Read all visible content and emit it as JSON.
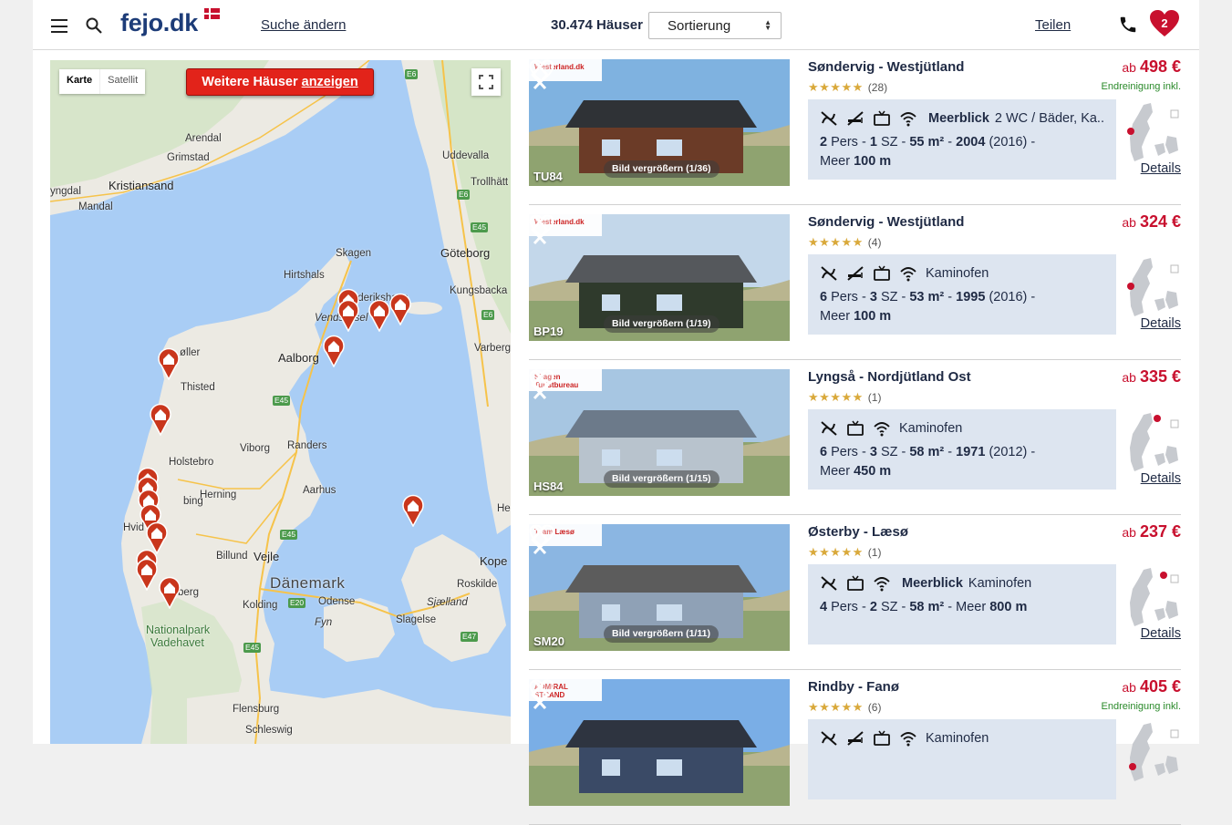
{
  "header": {
    "logo": "fejo.dk",
    "change_search": "Suche ändern",
    "result_count": "30.474 Häuser",
    "sort_label": "Sortierung",
    "share": "Teilen",
    "favorites_count": "2"
  },
  "map": {
    "type_map": "Karte",
    "type_satellite": "Satellit",
    "more_button_prefix": "Weitere Häuser",
    "more_button_link": "anzeigen",
    "labels": {
      "arendal": "Arendal",
      "grimstad": "Grimstad",
      "kristiansand": "Kristiansand",
      "mandal": "Mandal",
      "yngdal": "yngdal",
      "uddevalla": "Uddevalla",
      "trollhattan": "Trollhätt",
      "skagen": "Skagen",
      "goteborg": "Göteborg",
      "hirtshals": "Hirtshals",
      "frederikshavn": "Frederikshavn",
      "vendsyssel": "Vendsyssel",
      "kungsbacka": "Kungsbacka",
      "varberg": "Varberg",
      "aalborg": "Aalborg",
      "thisted": "Thisted",
      "holstebro": "Holstebro",
      "viborg": "Viborg",
      "randers": "Randers",
      "herning": "Herning",
      "aarhus": "Aarhus",
      "billund": "Billund",
      "vejle": "Vejle",
      "danemark": "Dänemark",
      "kolding": "Kolding",
      "odense": "Odense",
      "fyn": "Fyn",
      "sjaelland": "Sjælland",
      "roskilde": "Roskilde",
      "kope": "Kope",
      "slagelse": "Slagelse",
      "nationalpark": "Nationalpark",
      "vadehavet": "Vadehavet",
      "flensburg": "Flensburg",
      "schleswig": "Schleswig",
      "moller": "øller",
      "bing": "bing",
      "hvid": "Hvid",
      "berg": "berg",
      "he": "He"
    },
    "roads": {
      "e6a": "E6",
      "e6b": "E6",
      "e6c": "E6",
      "e45a": "E45",
      "e45b": "E45",
      "e45c": "E45",
      "e45d": "E45",
      "e6d": "E6",
      "e20": "E20",
      "e47": "E47",
      "e45e": "E45"
    }
  },
  "listings": [
    {
      "agency": "Westerland.dk",
      "code": "TU84",
      "enlarge": "Bild vergrößern (1/36)",
      "title": "Søndervig - Westjütland",
      "stars": "★★★★★",
      "rating_count": "(28)",
      "price_prefix": "ab",
      "price": "498 €",
      "cleaning": "Endreinigung inkl.",
      "highlight": "Meerblick",
      "features_text": "2 WC / Bäder, Ka...",
      "persons": "2",
      "persons_label": "Pers",
      "bedrooms": "1",
      "bedrooms_label": "SZ",
      "area": "55 m²",
      "year": "2004",
      "renovated": "(2016)",
      "sea_label": "Meer",
      "sea_distance": "100 m",
      "details": "Details"
    },
    {
      "agency": "Westerland.dk",
      "code": "BP19",
      "enlarge": "Bild vergrößern (1/19)",
      "title": "Søndervig - Westjütland",
      "stars": "★★★★★",
      "rating_count": "(4)",
      "price_prefix": "ab",
      "price": "324 €",
      "cleaning": "",
      "highlight": "",
      "features_text": "Kaminofen",
      "persons": "6",
      "persons_label": "Pers",
      "bedrooms": "3",
      "bedrooms_label": "SZ",
      "area": "53 m²",
      "year": "1995",
      "renovated": "(2016)",
      "sea_label": "Meer",
      "sea_distance": "100 m",
      "details": "Details"
    },
    {
      "agency": "Skagen Turistbureau",
      "code": "HS84",
      "enlarge": "Bild vergrößern (1/15)",
      "title": "Lyngså - Nordjütland Ost",
      "stars": "★★★★★",
      "rating_count": "(1)",
      "price_prefix": "ab",
      "price": "335 €",
      "cleaning": "",
      "highlight": "",
      "features_text": "Kaminofen",
      "persons": "6",
      "persons_label": "Pers",
      "bedrooms": "3",
      "bedrooms_label": "SZ",
      "area": "58 m²",
      "year": "1971",
      "renovated": "(2012)",
      "sea_label": "Meer",
      "sea_distance": "450 m",
      "details": "Details"
    },
    {
      "agency": "Team Læsø",
      "code": "SM20",
      "enlarge": "Bild vergrößern (1/11)",
      "title": "Østerby - Læsø",
      "stars": "★★★★★",
      "rating_count": "(1)",
      "price_prefix": "ab",
      "price": "237 €",
      "cleaning": "",
      "highlight": "Meerblick",
      "features_text": "Kaminofen",
      "persons": "4",
      "persons_label": "Pers",
      "bedrooms": "2",
      "bedrooms_label": "SZ",
      "area": "58 m²",
      "year": "",
      "renovated": "",
      "sea_label": "Meer",
      "sea_distance": "800 m",
      "details": "Details"
    },
    {
      "agency": "ADMIRAL STRAND",
      "code": "",
      "enlarge": "",
      "title": "Rindby - Fanø",
      "stars": "★★★★★",
      "rating_count": "(6)",
      "price_prefix": "ab",
      "price": "405 €",
      "cleaning": "Endreinigung inkl.",
      "highlight": "",
      "features_text": "Kaminofen",
      "persons": "",
      "persons_label": "",
      "bedrooms": "",
      "bedrooms_label": "",
      "area": "",
      "year": "",
      "renovated": "",
      "sea_label": "",
      "sea_distance": "",
      "details": ""
    }
  ],
  "colors": {
    "brand": "#1d3c78",
    "price": "#c8102e",
    "infobox": "#dde5f0",
    "map_water": "#a9cdf5",
    "map_land": "#eceae3",
    "pin": "#c9361c"
  },
  "icons": [
    "menu-icon",
    "search-icon",
    "phone-icon",
    "heart-icon",
    "no-pets-icon",
    "no-smoking-icon",
    "tv-icon",
    "wifi-icon",
    "chevron-left-icon",
    "chevron-right-icon",
    "fullscreen-icon",
    "house-pin-icon",
    "denmark-map-icon"
  ]
}
